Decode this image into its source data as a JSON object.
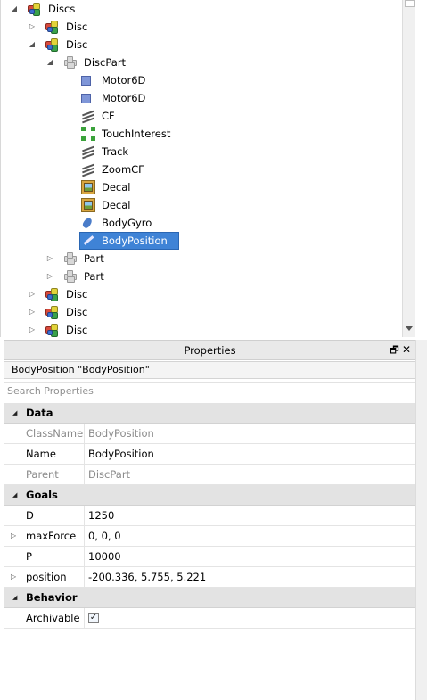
{
  "explorer": {
    "items": [
      {
        "label": "Discs",
        "icon": "model-icon",
        "expander": "expanded"
      },
      {
        "label": "Disc",
        "icon": "model-icon",
        "expander": "collapsed"
      },
      {
        "label": "Disc",
        "icon": "model-icon",
        "expander": "expanded"
      },
      {
        "label": "DiscPart",
        "icon": "part-icon",
        "expander": "expanded"
      },
      {
        "label": "Motor6D",
        "icon": "motor6d-icon",
        "expander": "none"
      },
      {
        "label": "Motor6D",
        "icon": "motor6d-icon",
        "expander": "none"
      },
      {
        "label": "CF",
        "icon": "cframe-value-icon",
        "expander": "none"
      },
      {
        "label": "TouchInterest",
        "icon": "touch-interest-icon",
        "expander": "none"
      },
      {
        "label": "Track",
        "icon": "cframe-value-icon",
        "expander": "none"
      },
      {
        "label": "ZoomCF",
        "icon": "cframe-value-icon",
        "expander": "none"
      },
      {
        "label": "Decal",
        "icon": "decal-icon",
        "expander": "none"
      },
      {
        "label": "Decal",
        "icon": "decal-icon",
        "expander": "none"
      },
      {
        "label": "BodyGyro",
        "icon": "body-gyro-icon",
        "expander": "none"
      },
      {
        "label": "BodyPosition",
        "icon": "body-position-icon",
        "expander": "none",
        "selected": true
      },
      {
        "label": "Part",
        "icon": "part-icon",
        "expander": "collapsed"
      },
      {
        "label": "Part",
        "icon": "part-icon",
        "expander": "collapsed"
      },
      {
        "label": "Disc",
        "icon": "model-icon",
        "expander": "collapsed"
      },
      {
        "label": "Disc",
        "icon": "model-icon",
        "expander": "collapsed"
      },
      {
        "label": "Disc",
        "icon": "model-icon",
        "expander": "collapsed"
      }
    ]
  },
  "properties": {
    "title": "Properties",
    "float_glyph": "🗗",
    "close_glyph": "✕",
    "selection": "BodyPosition \"BodyPosition\"",
    "search_placeholder": "Search Properties",
    "categories": [
      {
        "label": "Data",
        "rows": [
          {
            "name": "ClassName",
            "value": "BodyPosition",
            "readonly": true
          },
          {
            "name": "Name",
            "value": "BodyPosition"
          },
          {
            "name": "Parent",
            "value": "DiscPart",
            "readonly": true
          }
        ]
      },
      {
        "label": "Goals",
        "rows": [
          {
            "name": "D",
            "value": "1250"
          },
          {
            "name": "maxForce",
            "value": "0, 0, 0",
            "expandable": true
          },
          {
            "name": "P",
            "value": "10000"
          },
          {
            "name": "position",
            "value": "-200.336, 5.755, 5.221",
            "expandable": true
          }
        ]
      },
      {
        "label": "Behavior",
        "rows": [
          {
            "name": "Archivable",
            "value": "",
            "checkbox": true,
            "checked": true
          }
        ]
      }
    ]
  },
  "colors": {
    "selection_bg": "#3f83d6",
    "category_bg": "#e3e3e3"
  }
}
